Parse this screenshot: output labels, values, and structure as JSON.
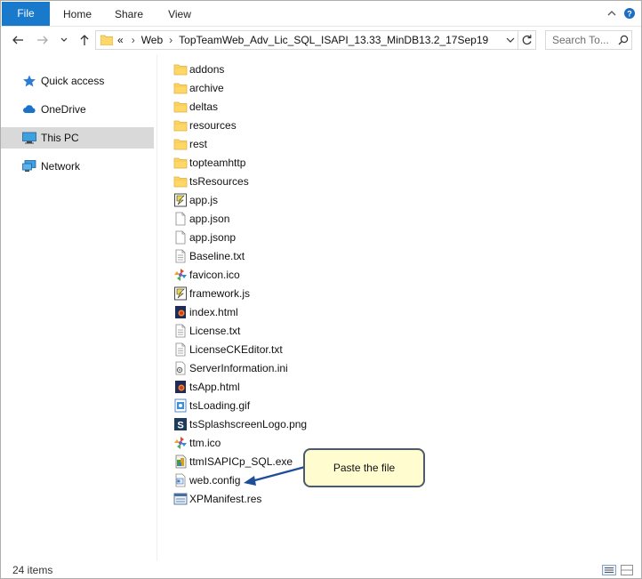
{
  "ribbon": {
    "tabs": [
      {
        "label": "File"
      },
      {
        "label": "Home"
      },
      {
        "label": "Share"
      },
      {
        "label": "View"
      }
    ]
  },
  "address": {
    "overflow": "«",
    "segments": [
      "Web",
      "TopTeamWeb_Adv_Lic_SQL_ISAPI_13.33_MinDB13.2_17Sep19"
    ]
  },
  "search": {
    "placeholder": "Search To..."
  },
  "navpane": {
    "items": [
      {
        "label": "Quick access",
        "icon": "star-icon"
      },
      {
        "label": "OneDrive",
        "icon": "cloud-icon"
      },
      {
        "label": "This PC",
        "icon": "computer-icon",
        "selected": true
      },
      {
        "label": "Network",
        "icon": "network-icon"
      }
    ]
  },
  "files": [
    {
      "name": "addons",
      "type": "folder"
    },
    {
      "name": "archive",
      "type": "folder"
    },
    {
      "name": "deltas",
      "type": "folder"
    },
    {
      "name": "resources",
      "type": "folder"
    },
    {
      "name": "rest",
      "type": "folder"
    },
    {
      "name": "topteamhttp",
      "type": "folder"
    },
    {
      "name": "tsResources",
      "type": "folder"
    },
    {
      "name": "app.js",
      "type": "js"
    },
    {
      "name": "app.json",
      "type": "blank"
    },
    {
      "name": "app.jsonp",
      "type": "blank"
    },
    {
      "name": "Baseline.txt",
      "type": "txt"
    },
    {
      "name": "favicon.ico",
      "type": "ico"
    },
    {
      "name": "framework.js",
      "type": "js"
    },
    {
      "name": "index.html",
      "type": "html"
    },
    {
      "name": "License.txt",
      "type": "txt"
    },
    {
      "name": "LicenseCKEditor.txt",
      "type": "txt"
    },
    {
      "name": "ServerInformation.ini",
      "type": "ini"
    },
    {
      "name": "tsApp.html",
      "type": "html"
    },
    {
      "name": "tsLoading.gif",
      "type": "gif"
    },
    {
      "name": "tsSplashscreenLogo.png",
      "type": "png"
    },
    {
      "name": "ttm.ico",
      "type": "ico"
    },
    {
      "name": "ttmISAPICp_SQL.exe",
      "type": "exe"
    },
    {
      "name": "web.config",
      "type": "config"
    },
    {
      "name": "XPManifest.res",
      "type": "res"
    }
  ],
  "status": {
    "item_count": "24 items"
  },
  "callout": {
    "text": "Paste the file"
  },
  "colors": {
    "file_tab": "#1979ca",
    "folder": "#ffd766",
    "selected_nav": "#d9d9d9",
    "callout_bg": "#fffdd0",
    "callout_border": "#4c5a6e",
    "arrow": "#1f4e99"
  }
}
